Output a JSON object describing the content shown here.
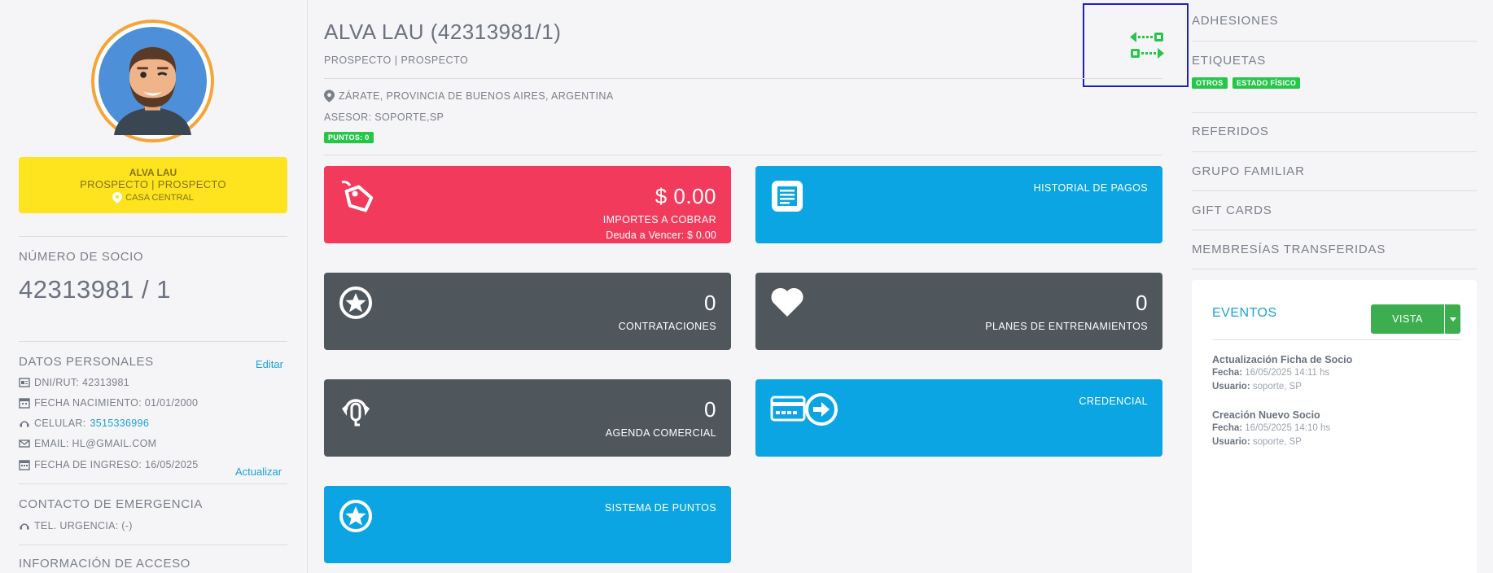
{
  "profile": {
    "name": "ALVA LAU",
    "status": "PROSPECTO | PROSPECTO",
    "branch": "CASA CENTRAL"
  },
  "member": {
    "number_label": "NÚMERO DE SOCIO",
    "number": "42313981 / 1"
  },
  "personal": {
    "title": "DATOS PERSONALES",
    "edit_label": "Editar",
    "dni": "DNI/RUT: 42313981",
    "birth": "FECHA NACIMIENTO: 01/01/2000",
    "cell_prefix": "CELULAR:",
    "cell": "3515336996",
    "email": "EMAIL: HL@GMAIL.COM",
    "join": "FECHA DE INGRESO: 16/05/2025",
    "update_label": "Actualizar"
  },
  "emergency": {
    "title": "CONTACTO DE EMERGENCIA",
    "phone": "TEL. URGENCIA: (-)"
  },
  "access": {
    "title": "INFORMACIÓN DE ACCESO"
  },
  "header": {
    "title": "ALVA LAU (42313981/1)",
    "subtitle": "PROSPECTO | PROSPECTO",
    "location": "ZÁRATE, PROVINCIA DE BUENOS AIRES, ARGENTINA",
    "advisor": "ASESOR: SOPORTE,SP",
    "points_badge": "PUNTOS: 0"
  },
  "tiles": {
    "cobrar": {
      "value": "$ 0.00",
      "label": "IMPORTES A COBRAR",
      "sub": "Deuda a Vencer: $ 0.00"
    },
    "historial": {
      "label": "HISTORIAL DE PAGOS"
    },
    "contrataciones": {
      "value": "0",
      "label": "CONTRATACIONES"
    },
    "planes": {
      "value": "0",
      "label": "PLANES DE ENTRENAMIENTOS"
    },
    "agenda": {
      "value": "0",
      "label": "AGENDA COMERCIAL"
    },
    "credencial": {
      "label": "CREDENCIAL"
    },
    "puntos": {
      "label": "SISTEMA DE PUNTOS"
    }
  },
  "right_menu": {
    "adhesiones": "ADHESIONES",
    "etiquetas": "ETIQUETAS",
    "tags": [
      "OTROS",
      "ESTADO FÍSICO"
    ],
    "referidos": "REFERIDOS",
    "grupo": "GRUPO FAMILIAR",
    "gift": "GIFT CARDS",
    "membresias": "MEMBRESÍAS TRANSFERIDAS"
  },
  "events": {
    "title": "EVENTOS",
    "view_button": "VISTA",
    "entries": [
      {
        "heading": "Actualización Ficha de Socio",
        "date_label": "Fecha:",
        "date": "16/05/2025 14:11 hs",
        "user_label": "Usuario:",
        "user": "soporte, SP"
      },
      {
        "heading": "Creación Nuevo Socio",
        "date_label": "Fecha:",
        "date": "16/05/2025 14:10 hs",
        "user_label": "Usuario:",
        "user": "soporte, SP"
      }
    ]
  },
  "colors": {
    "accent": "#1aa3d6",
    "green": "#26c749",
    "red_tile": "#f23b5c",
    "dark_tile": "#4f575d",
    "blue_tile": "#0aa5e2",
    "yellow_card": "#fde41f",
    "highlight_box": "#1e1ec8"
  },
  "icons": [
    "location-pin-icon",
    "tag-icon",
    "document-icon",
    "star-icon",
    "heart-icon",
    "headset-icon",
    "credit-card-icon",
    "arrow-right-circle-icon",
    "swap-arrows-icon",
    "id-card-icon",
    "calendar-icon",
    "phone-icon",
    "envelope-icon"
  ]
}
